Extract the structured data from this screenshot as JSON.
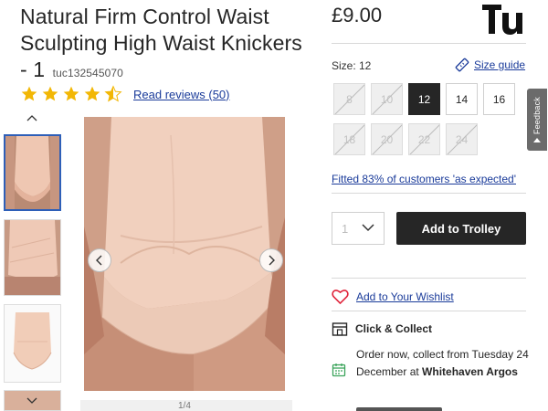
{
  "product": {
    "title": "Natural Firm Control Waist Sculpting High Waist Knickers - 1",
    "sku": "tuc132545070",
    "price": "£9.00",
    "brand_logo": "Tu",
    "rating": {
      "value": 4.5,
      "max": 5,
      "reviews_link": "Read reviews (50)"
    }
  },
  "gallery": {
    "counter": "1/4",
    "prev_icon": "chevron-left-icon",
    "next_icon": "chevron-right-icon",
    "thumbs_up_icon": "chevron-up-icon",
    "thumbs_down_icon": "chevron-down-icon"
  },
  "size": {
    "label": "Size: 12",
    "guide_label": "Size guide",
    "options": [
      {
        "label": "8",
        "state": "disabled"
      },
      {
        "label": "10",
        "state": "disabled"
      },
      {
        "label": "12",
        "state": "selected"
      },
      {
        "label": "14",
        "state": "available"
      },
      {
        "label": "16",
        "state": "available"
      },
      {
        "label": "18",
        "state": "disabled"
      },
      {
        "label": "20",
        "state": "disabled"
      },
      {
        "label": "22",
        "state": "disabled"
      },
      {
        "label": "24",
        "state": "disabled"
      }
    ],
    "fitted_text": "Fitted 83% of customers 'as expected'"
  },
  "purchase": {
    "quantity": "1",
    "add_label": "Add to Trolley",
    "wishlist_label": "Add to Your Wishlist"
  },
  "collect": {
    "title": "Click & Collect",
    "info_prefix": "Order now, collect from Tuesday 24 December at ",
    "store": "Whitehaven Argos"
  },
  "feedback_label": "Feedback",
  "colors": {
    "link": "#1a3b9a",
    "star": "#f2b705",
    "dark_button": "#262626",
    "wishlist_heart": "#e0233a",
    "calendar": "#3aa35a"
  }
}
